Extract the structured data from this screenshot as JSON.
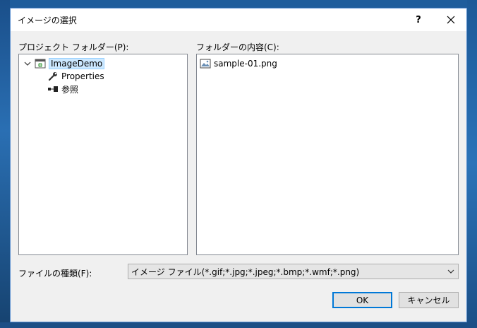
{
  "dialog": {
    "title": "イメージの選択",
    "help_label": "?",
    "close_label": "✕"
  },
  "project_panel": {
    "label": "プロジェクト フォルダー(P):",
    "tree": [
      {
        "label": "ImageDemo",
        "icon": "web-project-icon",
        "selected": true,
        "expanded": true
      },
      {
        "label": "Properties",
        "icon": "wrench-icon"
      },
      {
        "label": "参照",
        "icon": "references-icon"
      }
    ]
  },
  "contents_panel": {
    "label": "フォルダーの内容(C):",
    "files": [
      {
        "label": "sample-01.png",
        "icon": "image-file-icon"
      }
    ]
  },
  "file_type": {
    "label": "ファイルの種類(F):",
    "selected": "イメージ ファイル(*.gif;*.jpg;*.jpeg;*.bmp;*.wmf;*.png)"
  },
  "buttons": {
    "ok": "OK",
    "cancel": "キャンセル"
  },
  "colors": {
    "selection": "#cce8ff",
    "accent": "#0078d7"
  }
}
